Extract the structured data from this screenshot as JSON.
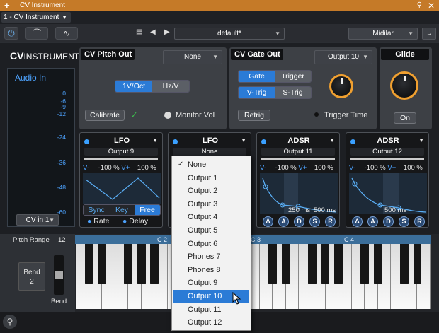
{
  "titlebar": {
    "add": "+",
    "title": "CV Instrument",
    "pin_icon": "pin-icon",
    "close": "✕"
  },
  "preset_row": {
    "selector": "1 - CV Instrument"
  },
  "toolbar": {
    "power_icon": "power-icon",
    "wave_icon": "arc-icon",
    "env_icon": "curve-icon",
    "preset": "default*",
    "device": "Midilar"
  },
  "logo": {
    "bold": "CV",
    "light": "INSTRUMENT"
  },
  "audio_in": {
    "label": "Audio In",
    "ticks": [
      "0",
      "-6",
      "-9",
      "-12",
      "-24",
      "-36",
      "-48",
      "-60"
    ],
    "input": "CV in 1"
  },
  "pitch_out": {
    "title": "CV Pitch Out",
    "output": "None",
    "modes": [
      "1V/Oct",
      "Hz/V"
    ],
    "active_mode": "1V/Oct",
    "calibrate": "Calibrate",
    "check": "✓",
    "monitor": "Monitor Vol"
  },
  "gate_out": {
    "title": "CV Gate Out",
    "output": "Output 10",
    "modes": [
      "Gate",
      "Trigger"
    ],
    "active_mode": "Gate",
    "trig_modes": [
      "V-Trig",
      "S-Trig"
    ],
    "active_trig": "V-Trig",
    "retrig": "Retrig",
    "trigger_time": "Trigger Time"
  },
  "glide": {
    "title": "Glide",
    "on": "On"
  },
  "slots": [
    {
      "title": "LFO",
      "output": "Output 9",
      "vminus": "V-",
      "vval": "-100 %",
      "vplus": "V+",
      "vpval": "100 %",
      "modes": [
        "Sync",
        "Key",
        "Free"
      ],
      "active": "Free",
      "rate": "Rate",
      "delay": "Delay"
    },
    {
      "title": "LFO",
      "output": "None"
    },
    {
      "title": "ADSR",
      "output": "Output 11",
      "vminus": "V-",
      "vval": "-100 %",
      "vplus": "V+",
      "vpval": "100 %",
      "t1": "250 ms",
      "t2": "500 ms",
      "buttons": [
        "Δ",
        "A",
        "D",
        "S",
        "R"
      ]
    },
    {
      "title": "ADSR",
      "output": "Output 12",
      "vminus": "V-",
      "vval": "-100 %",
      "vplus": "V+",
      "vpval": "100 %",
      "t1": "500 ms",
      "buttons": [
        "Δ",
        "A",
        "D",
        "S",
        "R"
      ]
    }
  ],
  "dropdown": {
    "items": [
      "None",
      "Output 1",
      "Output 2",
      "Output 3",
      "Output 4",
      "Output 5",
      "Output 6",
      "Phones 7",
      "Phones 8",
      "Output 9",
      "Output 10",
      "Output 11",
      "Output 12"
    ],
    "checked": "None",
    "highlighted": "Output 10"
  },
  "keyboard": {
    "pitch_range": "Pitch Range",
    "pitch_value": "12",
    "bend": "Bend",
    "bend_value": "2",
    "bend_label": "Bend",
    "octaves": [
      "C 2",
      "C 3",
      "C 4"
    ]
  },
  "bottom": {
    "search_icon": "search-icon"
  }
}
